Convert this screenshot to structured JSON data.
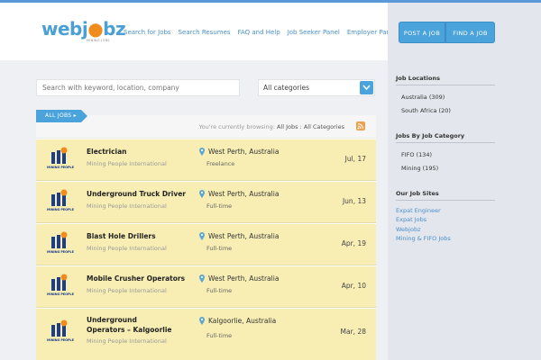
{
  "logo": {
    "part1": "web",
    "part2": "j",
    "part3": "bz",
    "tagline": "MINING JOBS"
  },
  "nav": [
    "Search for Jobs",
    "Search Resumes",
    "FAQ and Help",
    "Job Seeker Panel",
    "Employer Panel"
  ],
  "header_buttons": {
    "post": "POST A JOB",
    "find": "FIND A JOB"
  },
  "search": {
    "placeholder": "Search with keyword, location, company",
    "category": "All categories"
  },
  "list": {
    "tag": "ALL JOBS",
    "browsing_prefix": "You're currently browsing:",
    "browsing_value": "All Jobs : All Categories"
  },
  "jobs": [
    {
      "title": "Electrician",
      "company": "Mining People International",
      "location": "West Perth, Australia",
      "type": "Freelance",
      "date": "Jul, 17",
      "logo_text": "MINING PEOPLE"
    },
    {
      "title": "Underground Truck Driver",
      "company": "Mining People International",
      "location": "West Perth, Australia",
      "type": "Full-time",
      "date": "Jun, 13",
      "logo_text": "MINING PEOPLE"
    },
    {
      "title": "Blast Hole Drillers",
      "company": "Mining People International",
      "location": "West Perth, Australia",
      "type": "Full-time",
      "date": "Apr, 19",
      "logo_text": "MINING PEOPLE"
    },
    {
      "title": "Mobile Crusher Operators",
      "company": "Mining People International",
      "location": "West Perth, Australia",
      "type": "Full-time",
      "date": "Apr, 10",
      "logo_text": "MINING PEOPLE"
    },
    {
      "title": "Underground Operators – Kalgoorlie",
      "company": "Mining People International",
      "location": "Kalgoorlie, Australia",
      "type": "Full-time",
      "date": "Mar, 28",
      "logo_text": "MINING PEOPLE"
    }
  ],
  "sidebar": {
    "locations_title": "Job Locations",
    "locations": [
      "Australia (309)",
      "South Africa (20)"
    ],
    "categories_title": "Jobs By Job Category",
    "categories": [
      "FIFO (134)",
      "Mining (195)"
    ],
    "sites_title": "Our Job Sites",
    "sites": [
      "Expat Engineer",
      "Expat Jobs",
      "Webjobz",
      "Mining & FIFO Jobs"
    ]
  },
  "colors": {
    "accent": "#4ba3dc",
    "highlight_row": "#f8eeb4",
    "sidebar_bg": "#e3e6ec",
    "logo_orange": "#f08c1e"
  }
}
